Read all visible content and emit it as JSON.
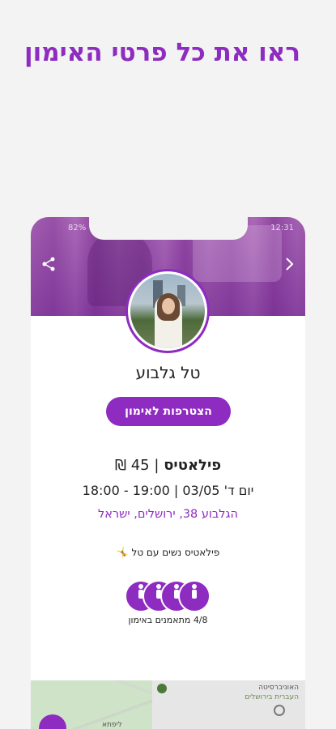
{
  "promo": {
    "title": "ראו את כל פרטי האימון"
  },
  "status_bar": {
    "battery": "82%",
    "time": "12:31"
  },
  "hero": {
    "share_icon": "share-icon",
    "back_icon": "chevron-right-icon"
  },
  "trainer": {
    "name": "טל גלבוע"
  },
  "join_button": {
    "label": "הצטרפות לאימון"
  },
  "class": {
    "type": "פילאטיס",
    "separator": "|",
    "price": "45 ₪",
    "time": "יום ד' 03/05 | 19:00 - 18:00",
    "address": "הגלבוע 38, ירושלים, ישראל",
    "description": "פילאטיס נשים עם טל 🤸"
  },
  "participants": {
    "label": "4/8 מתאמנים באימון",
    "count": 4
  },
  "map": {
    "label1": "האוניברסיטה",
    "label2": "העברית בירושלים",
    "label3": "ליפתא"
  },
  "colors": {
    "accent": "#8e2bc0"
  }
}
